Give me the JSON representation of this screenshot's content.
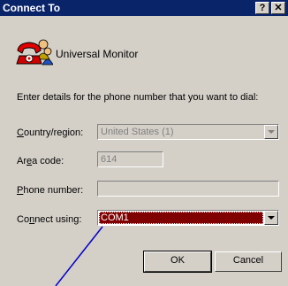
{
  "window": {
    "title": "Connect To",
    "help_label": "?",
    "close_label": "✕"
  },
  "connection": {
    "name": "Universal Monitor",
    "icon": "phone-icon"
  },
  "instructions": "Enter details for the phone number that you want to dial:",
  "fields": {
    "country": {
      "label_accel": "C",
      "label_rest": "ountry/region:",
      "value": "United States (1)"
    },
    "area": {
      "label_pre": "Ar",
      "label_accel": "e",
      "label_rest": "a code:",
      "value": "614"
    },
    "phone": {
      "label_accel": "P",
      "label_rest": "hone number:",
      "value": ""
    },
    "connect": {
      "label_pre": "Co",
      "label_accel": "n",
      "label_rest": "nect using:",
      "value": "COM1"
    }
  },
  "buttons": {
    "ok": "OK",
    "cancel": "Cancel"
  },
  "colors": {
    "titlebar": "#0a246a",
    "selection": "#800000",
    "pointer": "#0000cc"
  }
}
